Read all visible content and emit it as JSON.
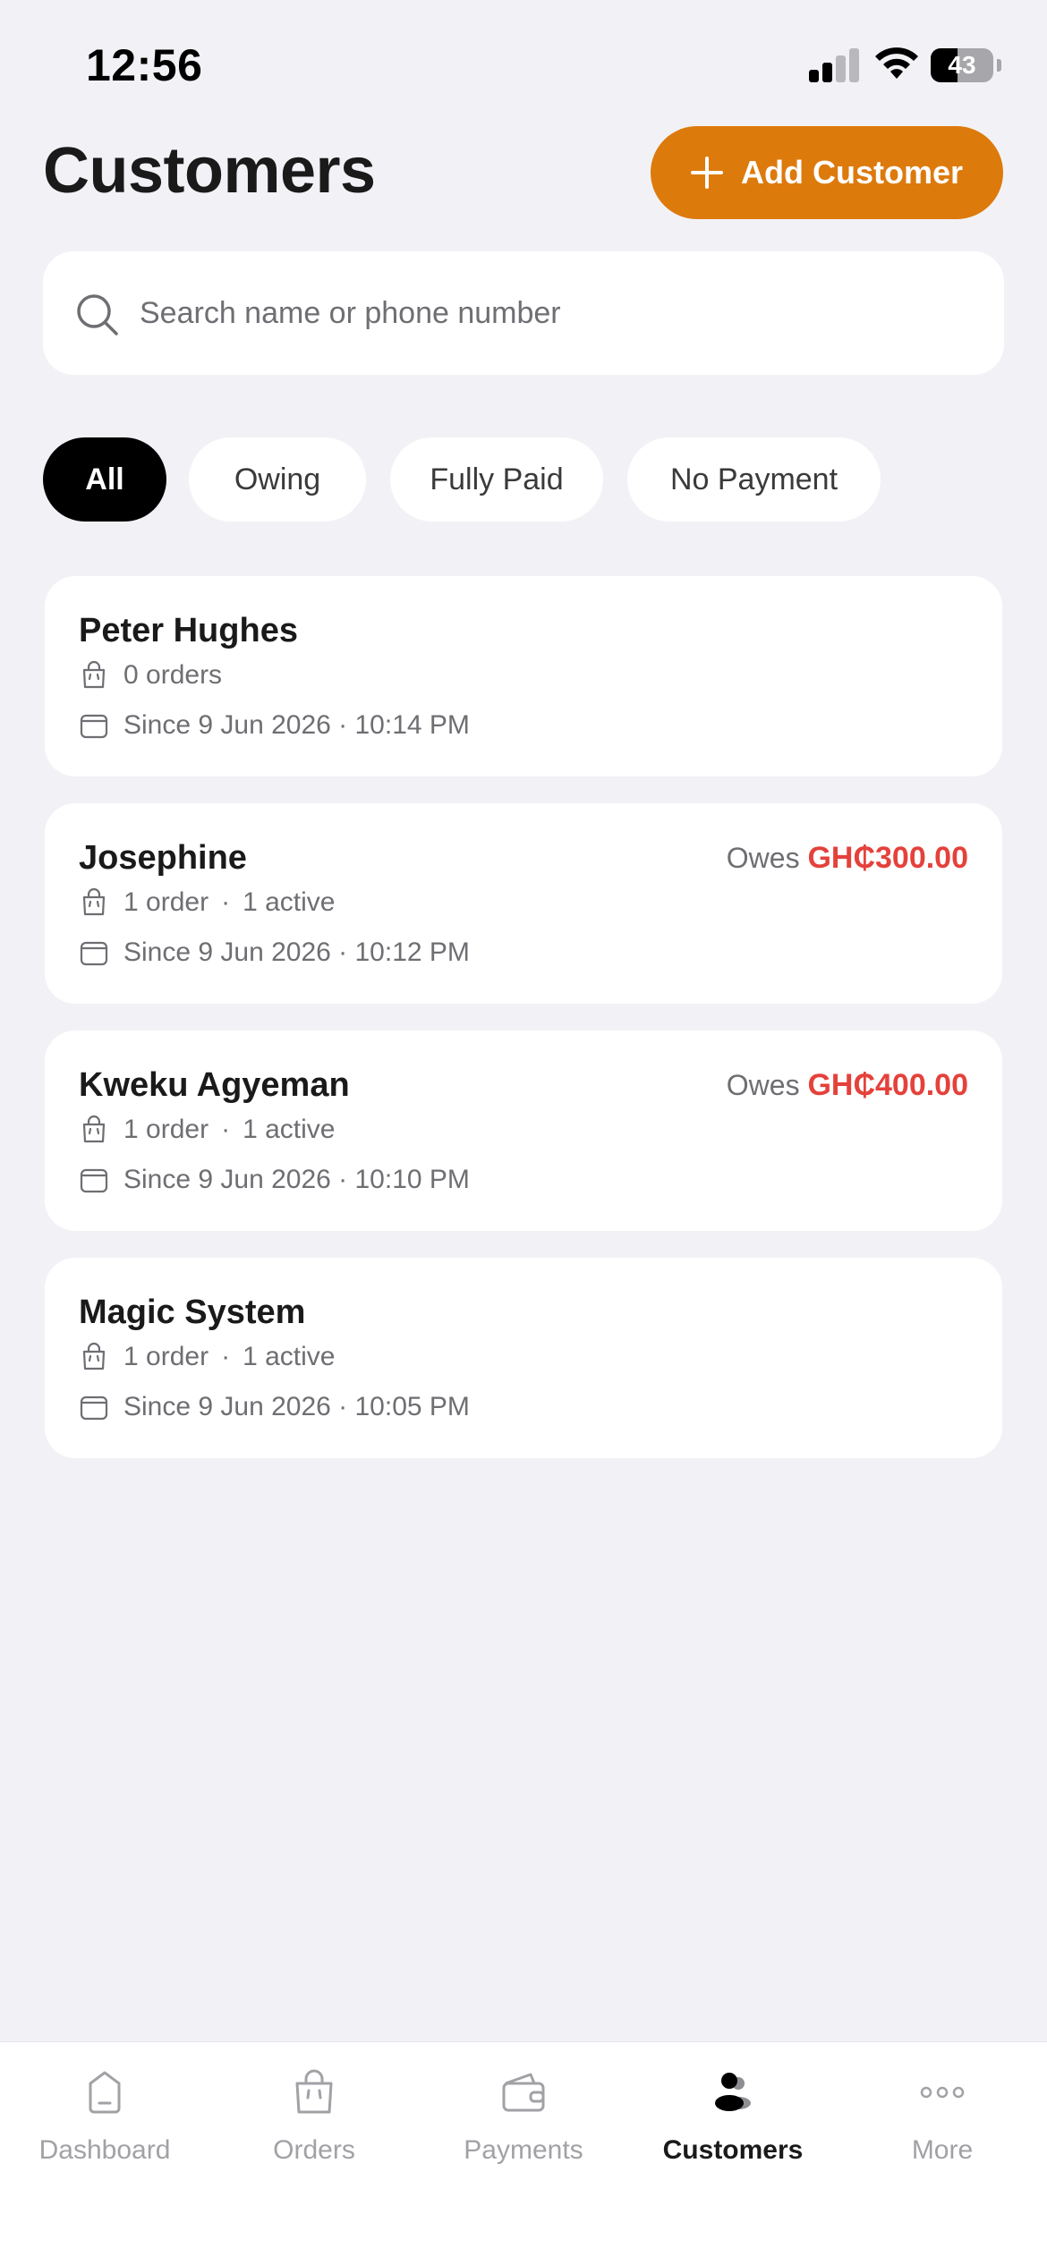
{
  "status_bar": {
    "time": "12:56",
    "battery": "43",
    "battery_level": 0.43
  },
  "header": {
    "title": "Customers",
    "add_button_label": "Add Customer"
  },
  "search": {
    "placeholder": "Search name or phone number",
    "value": ""
  },
  "filters": [
    {
      "label": "All",
      "active": true
    },
    {
      "label": "Owing",
      "active": false
    },
    {
      "label": "Fully Paid",
      "active": false
    },
    {
      "label": "No Payment",
      "active": false
    }
  ],
  "customers": [
    {
      "name": "Peter Hughes",
      "orders": "0 orders",
      "active": "",
      "since": "Since 9 Jun 2026 · 10:14 PM",
      "owes_label": "",
      "owes_amount": ""
    },
    {
      "name": "Josephine",
      "orders": "1 order",
      "active": "1 active",
      "since": "Since 9 Jun 2026 · 10:12 PM",
      "owes_label": "Owes",
      "owes_amount": "GH₵300.00"
    },
    {
      "name": "Kweku Agyeman",
      "orders": "1 order",
      "active": "1 active",
      "since": "Since 9 Jun 2026 · 10:10 PM",
      "owes_label": "Owes",
      "owes_amount": "GH₵400.00"
    },
    {
      "name": "Magic System",
      "orders": "1 order",
      "active": "1 active",
      "since": "Since 9 Jun 2026 · 10:05 PM",
      "owes_label": "",
      "owes_amount": ""
    }
  ],
  "tabs": [
    {
      "label": "Dashboard",
      "icon": "dashboard-icon",
      "active": false
    },
    {
      "label": "Orders",
      "icon": "shopping-bag-icon",
      "active": false
    },
    {
      "label": "Payments",
      "icon": "wallet-icon",
      "active": false
    },
    {
      "label": "Customers",
      "icon": "users-icon",
      "active": true
    },
    {
      "label": "More",
      "icon": "more-dots-icon",
      "active": false
    }
  ],
  "colors": {
    "accent": "#dd7a0c",
    "owes": "#e5413b",
    "background": "#f2f2f6",
    "active_chip": "#000000"
  }
}
